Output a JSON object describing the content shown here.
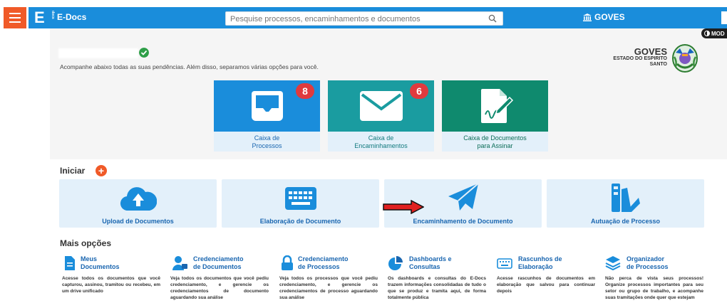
{
  "header": {
    "app_name": "E-Docs",
    "logo_letter": "E",
    "logo_sub": "docs",
    "search_placeholder": "Pesquise processos, encaminhamentos e documentos",
    "org_label": "GOVES",
    "mode_label": "MOD"
  },
  "greeting": {
    "text": "Acompanhe abaixo todas as suas pendências. Além disso, separamos várias opções para você."
  },
  "gov": {
    "title": "GOVES",
    "subtitle_line1": "ESTADO DO ESPIRITO",
    "subtitle_line2": "SANTO"
  },
  "cards": [
    {
      "line1": "Caixa de",
      "line2": "Processos",
      "badge": "8",
      "color": "#1a8ddb"
    },
    {
      "line1": "Caixa de",
      "line2": "Encaminhamentos",
      "badge": "6",
      "color": "#1a9ca0"
    },
    {
      "line1": "Caixa de Documentos",
      "line2": "para Assinar",
      "badge": "",
      "color": "#0f8a6e"
    }
  ],
  "iniciar": {
    "title": "Iniciar",
    "plus": "+",
    "tiles": [
      {
        "label": "Upload de Documentos",
        "icon": "cloud-upload-icon"
      },
      {
        "label": "Elaboração de Documento",
        "icon": "keyboard-icon"
      },
      {
        "label": "Encaminhamento de Documento",
        "icon": "paper-plane-icon"
      },
      {
        "label": "Autuação de Processo",
        "icon": "folders-icon"
      }
    ]
  },
  "mais_opcoes": {
    "title": "Mais opções",
    "items": [
      {
        "title1": "Meus",
        "title2": "Documentos",
        "desc": "Acesse todos os documentos que você capturou, assinou, tramitou ou recebeu, em um drive unificado",
        "icon": "document-icon"
      },
      {
        "title1": "Credenciamento",
        "title2": "de Documentos",
        "desc": "Veja todos os documentos que você pediu credenciamento, e gerencie os credenciamentos de documento aguardando sua análise",
        "icon": "user-lock-icon"
      },
      {
        "title1": "Credenciamento",
        "title2": "de Processos",
        "desc": "Veja todos os processos que você pediu credenciamento, e gerencie os credenciamentos de processo aguardando sua análise",
        "icon": "lock-icon"
      },
      {
        "title1": "Dashboards e",
        "title2": "Consultas",
        "desc": "Os dashboards e consultas do E-Docs trazem informações consolidadas de tudo o que se produz e tramita aqui, de forma totalmente pública",
        "icon": "pie-chart-icon"
      },
      {
        "title1": "Rascunhos de",
        "title2": "Elaboração",
        "desc": "Acesse rascunhos de documentos em elaboração que salvou para continuar depois",
        "icon": "keyboard-icon"
      },
      {
        "title1": "Organizador",
        "title2": "de Processos",
        "desc": "Não perca de vista seus processos! Organize processos importantes para seu setor ou grupo de trabalho, e acompanhe suas tramitações onde quer que estejam",
        "icon": "layers-icon"
      }
    ]
  }
}
